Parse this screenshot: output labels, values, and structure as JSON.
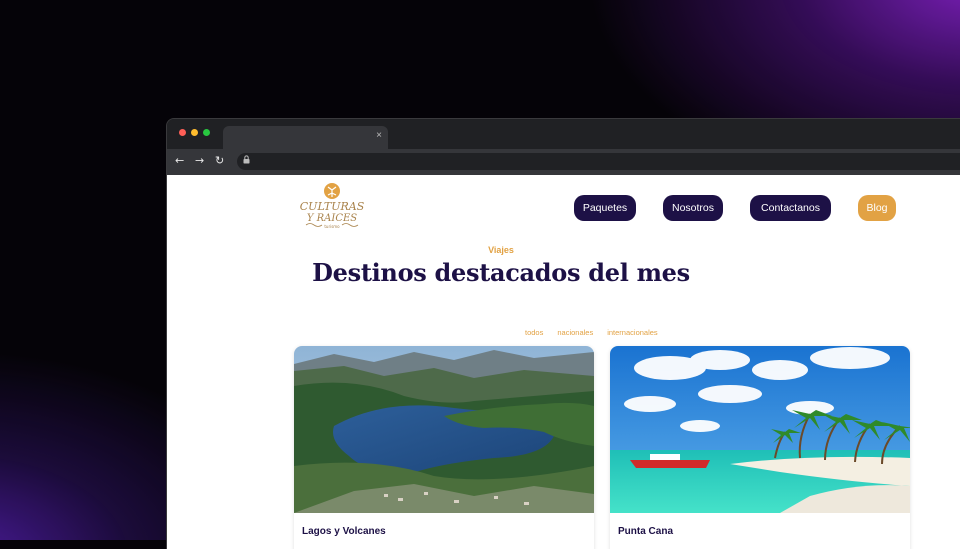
{
  "browser": {
    "tab_close": "×",
    "nav": {
      "back": "←",
      "forward": "→",
      "reload": "↻"
    },
    "lock": "🔒"
  },
  "site": {
    "logo": {
      "line1": "CULTURAS",
      "line2": "Y RAICES",
      "tagline": "turismo"
    },
    "nav": [
      {
        "label": "Paquetes"
      },
      {
        "label": "Nosotros"
      },
      {
        "label": "Contactanos"
      },
      {
        "label": "Blog"
      }
    ]
  },
  "section": {
    "eyebrow": "Viajes",
    "title": "Destinos destacados del mes",
    "filters": [
      "todos",
      "nacionales",
      "internacionales"
    ]
  },
  "cards": [
    {
      "title": "Lagos y Volcanes",
      "image": "mountain-lake-photo"
    },
    {
      "title": "Punta Cana",
      "image": "tropical-beach-photo"
    }
  ],
  "colors": {
    "brand_dark": "#1d1146",
    "accent": "#e2a244",
    "dot_red": "#ff5f57",
    "dot_yellow": "#febc2e",
    "dot_green": "#28c840"
  }
}
